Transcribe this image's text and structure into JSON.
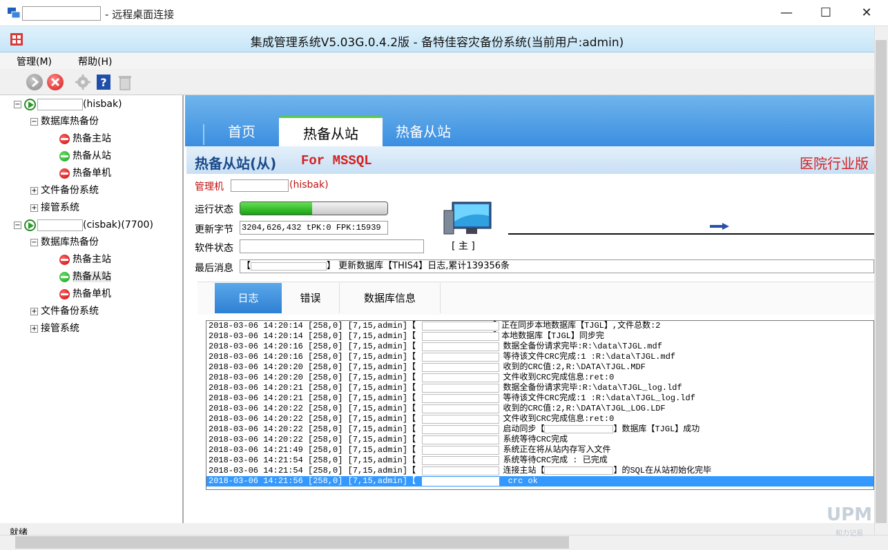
{
  "rdp_window": {
    "title": "- 远程桌面连接",
    "controls": {
      "minimize": "—",
      "maximize": "☐",
      "close": "✕"
    }
  },
  "app": {
    "title": "集成管理系统V5.03G.0.4.2版  - 备特佳容灾备份系统(当前用户:admin)"
  },
  "menu": {
    "items": [
      "管理(M)",
      "帮助(H)"
    ]
  },
  "toolbar": {
    "icons": [
      "go-icon",
      "stop-icon",
      "settings-icon",
      "help-icon",
      "trash-icon"
    ]
  },
  "tree": {
    "host1": {
      "suffix": "(hisbak)",
      "db_group": "数据库热备份",
      "items": [
        "热备主站",
        "热备从站",
        "热备单机"
      ],
      "file_backup": "文件备份系统",
      "takeover": "接管系统"
    },
    "host2": {
      "suffix": "(cisbak)(7700)",
      "db_group": "数据库热备份",
      "items": [
        "热备主站",
        "热备从站",
        "热备单机"
      ],
      "file_backup": "文件备份系统",
      "takeover": "接管系统"
    }
  },
  "tabs": [
    "首页",
    "热备从站",
    "热备从站"
  ],
  "section": {
    "title": "热备从站(从)",
    "subtitle": "For MSSQL",
    "right_text": "医院行业版"
  },
  "manager": {
    "label": "管理机",
    "suffix": "(hisbak)"
  },
  "fields": {
    "run_status_label": "运行状态",
    "run_progress": 0.49,
    "update_bytes_label": "更新字节",
    "update_bytes_value": "3204,626,432 tPK:0 FPK:15939",
    "software_status_label": "软件状态",
    "software_status_value": "",
    "last_msg_label": "最后消息",
    "last_msg_prefix": "【",
    "last_msg_mid": "】",
    "last_msg_text": "更新数据库【THIS4】日志,累计139356条"
  },
  "monitor_label": "[ 主 ]",
  "log_tabs": [
    "日志",
    "错误",
    "数据库信息"
  ],
  "log_rows": [
    {
      "ts": "2018-03-06 14:20:14",
      "code": "[258,0]",
      "user": "[7,15,admin]【",
      "msg": "】正在同步本地数据库【TJGL】,文件总数:2"
    },
    {
      "ts": "2018-03-06 14:20:14",
      "code": "[258,0]",
      "user": "[7,15,admin]【",
      "msg": "】本地数据库【TJGL】同步完"
    },
    {
      "ts": "2018-03-06 14:20:16",
      "code": "[258,0]",
      "user": "[7,15,admin]【",
      "msg": "  数据全备份请求完毕:R:\\data\\TJGL.mdf"
    },
    {
      "ts": "2018-03-06 14:20:16",
      "code": "[258,0]",
      "user": "[7,15,admin]【",
      "msg": "  等待该文件CRC完成:1 :R:\\data\\TJGL.mdf"
    },
    {
      "ts": "2018-03-06 14:20:20",
      "code": "[258,0]",
      "user": "[7,15,admin]【",
      "msg": "  收到的CRC值:2,R:\\DATA\\TJGL.MDF"
    },
    {
      "ts": "2018-03-06 14:20:20",
      "code": "[258,0]",
      "user": "[7,15,admin]【",
      "msg": "  文件收到CRC完成信息:ret:0"
    },
    {
      "ts": "2018-03-06 14:20:21",
      "code": "[258,0]",
      "user": "[7,15,admin]【",
      "msg": "  数据全备份请求完毕:R:\\data\\TJGL_log.ldf"
    },
    {
      "ts": "2018-03-06 14:20:21",
      "code": "[258,0]",
      "user": "[7,15,admin]【",
      "msg": "  等待该文件CRC完成:1 :R:\\data\\TJGL_log.ldf"
    },
    {
      "ts": "2018-03-06 14:20:22",
      "code": "[258,0]",
      "user": "[7,15,admin]【",
      "msg": "  收到的CRC值:2,R:\\DATA\\TJGL_LOG.LDF"
    },
    {
      "ts": "2018-03-06 14:20:22",
      "code": "[258,0]",
      "user": "[7,15,admin]【",
      "msg": "  文件收到CRC完成信息:ret:0"
    },
    {
      "ts": "2018-03-06 14:20:22",
      "code": "[258,0]",
      "user": "[7,15,admin]【",
      "msg": "  启动同步【",
      "msg2": "】数据库【TJGL】成功"
    },
    {
      "ts": "2018-03-06 14:20:22",
      "code": "[258,0]",
      "user": "[7,15,admin]【",
      "msg": "  系统等待CRC完成"
    },
    {
      "ts": "2018-03-06 14:21:49",
      "code": "[258,0]",
      "user": "[7,15,admin]【",
      "msg": "  系统正在将从站内存写入文件"
    },
    {
      "ts": "2018-03-06 14:21:54",
      "code": "[258,0]",
      "user": "[7,15,admin]【",
      "msg": "  系统等待CRC完成 : 已完成"
    },
    {
      "ts": "2018-03-06 14:21:54",
      "code": "[258,0]",
      "user": "[7,15,admin]【",
      "msg": "  连接主站【",
      "msg2": "】的SQL在从站初始化完毕"
    },
    {
      "ts": "2018-03-06 14:21:56",
      "code": "[258,0]",
      "user": "[7,15,admin]【",
      "msg": ")  crc ok",
      "selected": true
    }
  ],
  "status": {
    "text": "就绪"
  },
  "watermark": {
    "text": "和力记易"
  },
  "colors": {
    "accent": "#3b8ee0",
    "alert_red": "#d42020",
    "ok_green": "#17a210",
    "selection": "#3399ff"
  }
}
